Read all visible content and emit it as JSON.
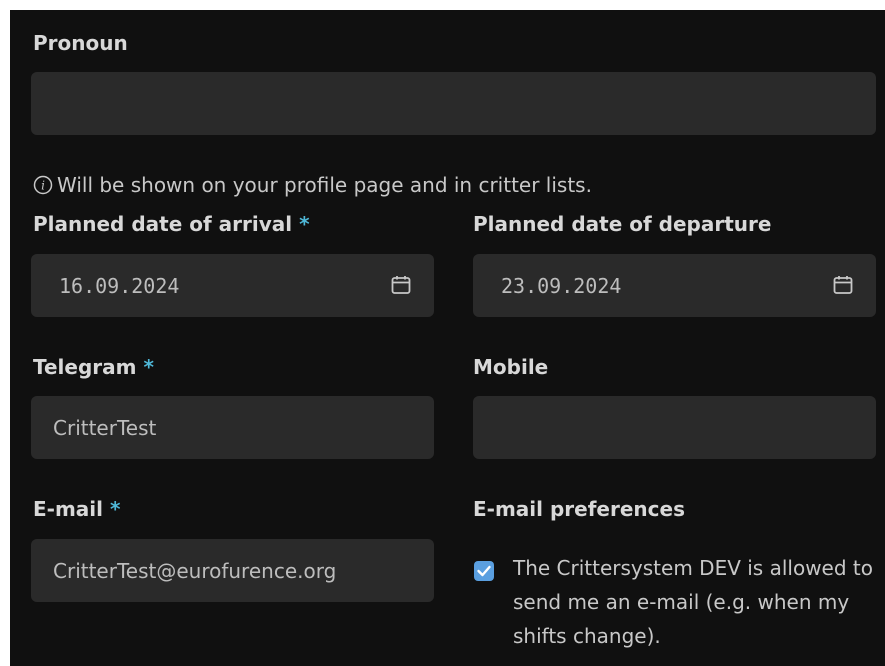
{
  "pronoun": {
    "label": "Pronoun",
    "value": "",
    "hint": "Will be shown on your profile page and in critter lists."
  },
  "arrival": {
    "label": "Planned date of arrival",
    "required_mark": "*",
    "value": "16.09.2024"
  },
  "departure": {
    "label": "Planned date of departure",
    "value": "23.09.2024"
  },
  "telegram": {
    "label": "Telegram",
    "required_mark": "*",
    "value": "CritterTest"
  },
  "mobile": {
    "label": "Mobile",
    "value": ""
  },
  "email": {
    "label": "E-mail",
    "required_mark": "*",
    "value": "CritterTest@eurofurence.org"
  },
  "email_preferences": {
    "label": "E-mail preferences",
    "checked": true,
    "checkbox_text": "The Crittersystem DEV is allowed to send me an e-mail (e.g. when my shifts change)."
  },
  "colors": {
    "background": "#101010",
    "field": "#2a2a2a",
    "required": "#4fb8d8",
    "checkbox": "#5a9fe0"
  }
}
